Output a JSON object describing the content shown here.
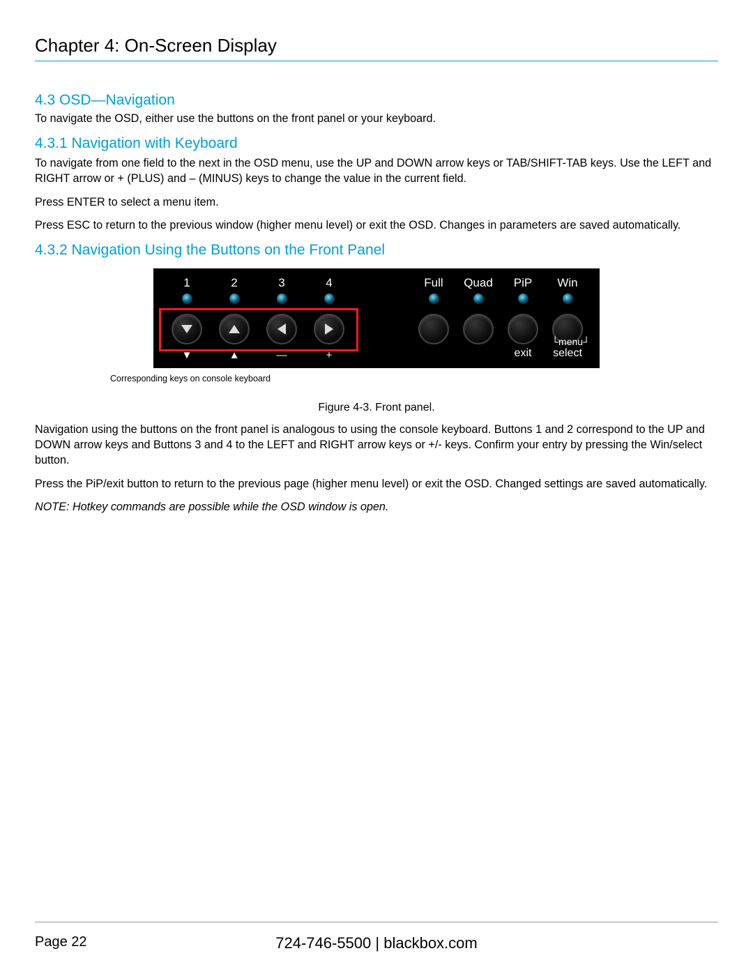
{
  "chapter_title": "Chapter 4: On-Screen Display",
  "sec43": {
    "heading": "4.3 OSD—Navigation",
    "p1": "To navigate the OSD, either use the buttons on the front panel or your keyboard."
  },
  "sec431": {
    "heading": "4.3.1 Navigation with Keyboard",
    "p1": "To navigate from one field to the next in the OSD menu, use the UP and DOWN arrow keys or TAB/SHIFT-TAB keys. Use the LEFT and RIGHT arrow or + (PLUS) and – (MINUS) keys to change the value in the current field.",
    "p2": "Press ENTER to select a menu item.",
    "p3": "Press ESC to return to the previous window (higher menu level) or exit the OSD. Changes in parameters are saved automatically."
  },
  "sec432": {
    "heading": "4.3.2 Navigation Using the Buttons on the Front Panel",
    "panel": {
      "top_left": [
        "1",
        "2",
        "3",
        "4"
      ],
      "top_right": [
        "Full",
        "Quad",
        "PiP",
        "Win"
      ],
      "bottom_left": [
        "▼",
        "▲",
        "—",
        "+"
      ],
      "menu_label": "menu",
      "exit_label": "exit",
      "select_label": "select"
    },
    "corresponding": "Corresponding keys on console keyboard",
    "caption": "Figure 4-3. Front panel.",
    "p1": "Navigation using the buttons on the front panel is analogous to using the console keyboard. Buttons 1 and 2 correspond to the UP and DOWN arrow keys and Buttons 3 and 4 to the LEFT and RIGHT arrow keys or +/- keys. Confirm your entry by pressing the Win/select button.",
    "p2": "Press the PiP/exit button to return to the previous page (higher menu level) or exit the OSD. Changed settings are saved automatically.",
    "note": "NOTE: Hotkey commands are possible while the OSD window is open."
  },
  "footer": {
    "page": "Page 22",
    "phone": "724-746-5500",
    "sep": "   |   ",
    "site": "blackbox.com"
  }
}
